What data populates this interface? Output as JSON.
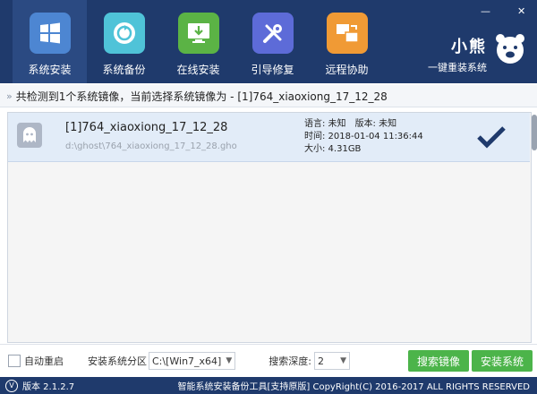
{
  "window": {
    "minimize_glyph": "—",
    "close_glyph": "✕"
  },
  "nav": {
    "items": [
      {
        "label": "系统安装",
        "icon": "windows-logo-icon",
        "color": "#4d86d2",
        "active": true
      },
      {
        "label": "系统备份",
        "icon": "backup-restore-icon",
        "color": "#4fc3d8",
        "active": false
      },
      {
        "label": "在线安装",
        "icon": "download-monitor-icon",
        "color": "#5bb345",
        "active": false
      },
      {
        "label": "引导修复",
        "icon": "repair-tools-icon",
        "color": "#5d6bd8",
        "active": false
      },
      {
        "label": "远程协助",
        "icon": "remote-assist-icon",
        "color": "#f09a35",
        "active": false
      }
    ]
  },
  "brand": {
    "name": "小熊",
    "slogan": "一键重装系统",
    "logo_icon": "bear-logo-icon"
  },
  "status": {
    "chevron": "»",
    "text": "共检测到1个系统镜像，当前选择系统镜像为 - [1]764_xiaoxiong_17_12_28"
  },
  "images": [
    {
      "name": "[1]764_xiaoxiong_17_12_28",
      "path": "d:\\ghost\\764_xiaoxiong_17_12_28.gho",
      "language_label": "语言: 未知",
      "version_label": "版本: 未知",
      "time_label": "时间: 2018-01-04 11:36:44",
      "size_label": "大小: 4.31GB",
      "selected": true
    }
  ],
  "bottom": {
    "auto_restart_label": "自动重启",
    "auto_restart_checked": false,
    "partition_label": "安装系统分区",
    "partition_value": "C:\\[Win7_x64]",
    "depth_label": "搜索深度:",
    "depth_value": "2",
    "search_button": "搜索镜像",
    "install_button": "安装系统"
  },
  "footer": {
    "version": "版本 2.1.2.7",
    "copyright": "智能系统安装备份工具[支持原版] CopyRight(C) 2016-2017 ALL RIGHTS RESERVED"
  },
  "colors": {
    "header_bg": "#1f3a6c",
    "active_nav_bg": "#2b4a82",
    "selected_row_bg": "#e2ecf8",
    "button_green": "#4cb44a",
    "check_mark": "#1f3a6c"
  }
}
